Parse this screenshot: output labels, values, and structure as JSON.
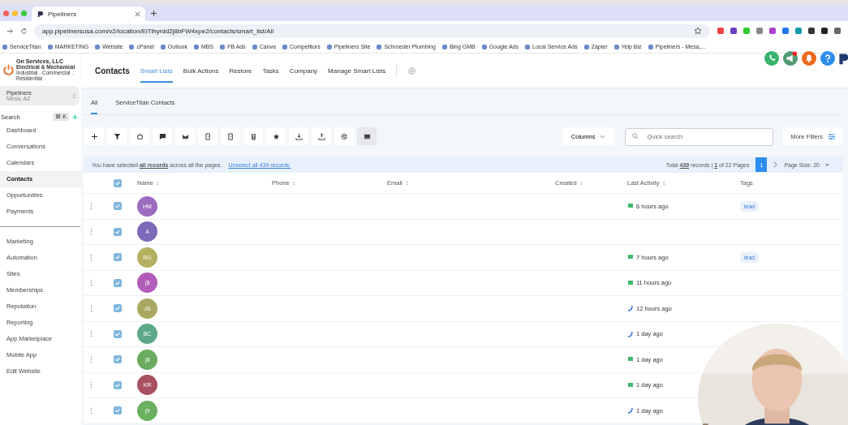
{
  "browser": {
    "tab_title": "Pipeliners",
    "url": "app.pipelinersusa.com/v2/location/EiTihyrdd2j8bFW4xpe2/contacts/smart_list/All",
    "bookmarks": [
      "ServiceTitan",
      "MARKETING",
      "Website",
      "cPanel",
      "Outlook",
      "MBS",
      "FB Ads",
      "Canva",
      "Competitors",
      "Pipeliners Site",
      "Schroeder Plumbing",
      "Bing GMB",
      "Google Ads",
      "Local Service Ads",
      "Zapier",
      "Yelp Biz",
      "Pipeliners - Mesa,..."
    ]
  },
  "sidebar": {
    "brand": "On Services, LLC",
    "brand_line": "Electrical & Mechanical",
    "brand_sub": "Industrial . Commercial . Residential",
    "location": "Pipeliners",
    "location_sub": "Mesa, AZ",
    "search": "Search",
    "shortcut": "⌘ K",
    "groups": [
      [
        {
          "label": "Dashboard",
          "selected": false
        },
        {
          "label": "Conversations",
          "selected": false
        },
        {
          "label": "Calendars",
          "selected": false
        },
        {
          "label": "Contacts",
          "selected": true
        },
        {
          "label": "Opportunities",
          "selected": false
        },
        {
          "label": "Payments",
          "selected": false
        }
      ],
      [
        {
          "label": "Marketing",
          "selected": false
        },
        {
          "label": "Automation",
          "selected": false
        },
        {
          "label": "Sites",
          "selected": false
        },
        {
          "label": "Memberships",
          "selected": false
        },
        {
          "label": "Reputation",
          "selected": false
        },
        {
          "label": "Reporting",
          "selected": false
        },
        {
          "label": "App Marketplace",
          "selected": false
        },
        {
          "label": "Mobile App",
          "selected": false
        },
        {
          "label": "Edit Website",
          "selected": false
        }
      ]
    ]
  },
  "header": {
    "title": "Contacts",
    "tabs": [
      {
        "label": "Smart Lists",
        "selected": true
      },
      {
        "label": "Bulk Actions",
        "selected": false
      },
      {
        "label": "Restore",
        "selected": false
      },
      {
        "label": "Tasks",
        "selected": false
      },
      {
        "label": "Company",
        "selected": false
      },
      {
        "label": "Manage Smart Lists",
        "selected": false
      }
    ]
  },
  "lists": [
    {
      "label": "All",
      "selected": true
    },
    {
      "label": "ServiceTitan Contacts",
      "selected": false
    }
  ],
  "toolbar": {
    "columns": "Columns",
    "search_placeholder": "Quick search",
    "more_filters": "More Filters"
  },
  "banner": {
    "text": "You have selected **all records** across all the pages.",
    "link": "Unselect all 439 records.",
    "total": "Total **439** records | **1** of 22 Pages",
    "page": "1",
    "page_size": "Page Size: 20"
  },
  "table": {
    "all_checked": true,
    "columns": [
      "Name",
      "Phone",
      "Email",
      "Created",
      "Last Activity",
      "Tags"
    ],
    "rows": [
      {
        "initials": "HM",
        "color": "#9b6bc0",
        "checked": true,
        "kind": "message",
        "activity": "6 hours ago",
        "tag": "lead"
      },
      {
        "initials": "A",
        "color": "#7b68b8",
        "checked": true
      },
      {
        "initials": "RG",
        "color": "#b5b060",
        "checked": true,
        "kind": "message",
        "activity": "7 hours ago",
        "tag": "lead"
      },
      {
        "initials": "(8",
        "color": "#b05cb8",
        "checked": true,
        "kind": "message",
        "activity": "11 hours ago"
      },
      {
        "initials": "JS",
        "color": "#a8a860",
        "checked": true,
        "kind": "call",
        "activity": "12 hours ago"
      },
      {
        "initials": "BC",
        "color": "#5ea88a",
        "checked": true,
        "kind": "call",
        "activity": "1 day ago"
      },
      {
        "initials": "(8",
        "color": "#6aab5e",
        "checked": true,
        "kind": "message",
        "activity": "1 day ago"
      },
      {
        "initials": "KR",
        "color": "#a85060",
        "checked": true,
        "kind": "message",
        "activity": "1 day ago"
      },
      {
        "initials": "(9",
        "color": "#6ab05e",
        "checked": true,
        "kind": "call",
        "activity": "1 day ago"
      }
    ]
  }
}
